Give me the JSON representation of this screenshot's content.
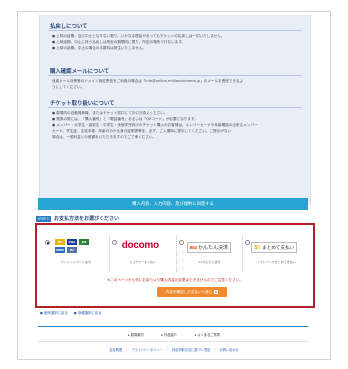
{
  "info": {
    "refund_title": "払戻しについて",
    "refund_lines": [
      "● 上映の延期、及び中止となりない限り、いかなる理由があってもチケットの払戻しは一切いたしません。",
      "● 上映延期、中止に伴う払戻しは所定の期間内に限り、所定の場所で行ないます。",
      "● 上映の延期、中止の場合の手数料は発生いたしません。"
    ],
    "email_title": "購入確認メールについて",
    "email_lines": [
      "迷惑メール対策等のドメイン指定受信をご利用の場合は「info@online-midlandcinema.jp」のメールを受信できるよ",
      "うにしてください。"
    ],
    "ticket_title": "チケット取り扱いについて",
    "ticket_lines": [
      "● 劇場内の自動発券機、またはチケット窓口にてお引き換えください。",
      "● 発券の際には、「購入番号」と「電話番号」あるいは「QRコード」が必要となります。",
      "● メンバー・大学生・高校生・中学生・未就学児向けのチケット購入のお客様は、メンバーカードや年齢確認の出来るメンバー",
      "   カード、学生証、生徒手帳、年齢の分かる身分証明書等を、必ず、ご入場時に提示してください。ご提示がない",
      "   場合は、一般料金との差額をいただきますのでご了承ください。"
    ],
    "confirm_label": "購入内容、入力内容、及び規約に同意する"
  },
  "step": {
    "badge": "STEP 1",
    "title": "お支払方法をお選びください"
  },
  "payment": {
    "methods": [
      {
        "caption": "クレジットカード決済",
        "selected": true
      },
      {
        "caption": "ドコモケータイ払い",
        "selected": false,
        "logo_text": "docomo"
      },
      {
        "caption": "auかんたん決済",
        "selected": false,
        "logo_prefix": "au",
        "logo_text": "かんたん決済"
      },
      {
        "caption": "ソフトバンクまとめて支払い",
        "selected": false,
        "logo_prefix": "S!",
        "logo_text": "まとめて支払い"
      }
    ],
    "card_brands": [
      "VISA",
      "MC",
      "JCB",
      "AMEX",
      "DC"
    ],
    "notice": "※このページから先にお戻りより購入内容の変更はできませんのでご注意ください。",
    "next_button": "内容を確認しお支払いへ進む",
    "next_arrow": "▶"
  },
  "back_links": [
    "● 座席選択に戻る",
    "● 券種選択に戻る"
  ],
  "footer": {
    "nav": [
      "▸ 劇場案内",
      "▸ 作品紹介",
      "▸ よくあるご質問"
    ],
    "links": [
      "会社概要",
      "プライバシーポリシー",
      "特定商取引法に基づく表記",
      "お問い合わせ"
    ],
    "separator": "|"
  },
  "colors": {
    "accent_blue": "#27a5d1",
    "highlight_border": "#b3202a",
    "next_button": "#ef8a2f",
    "notice_red": "#c0242f"
  }
}
